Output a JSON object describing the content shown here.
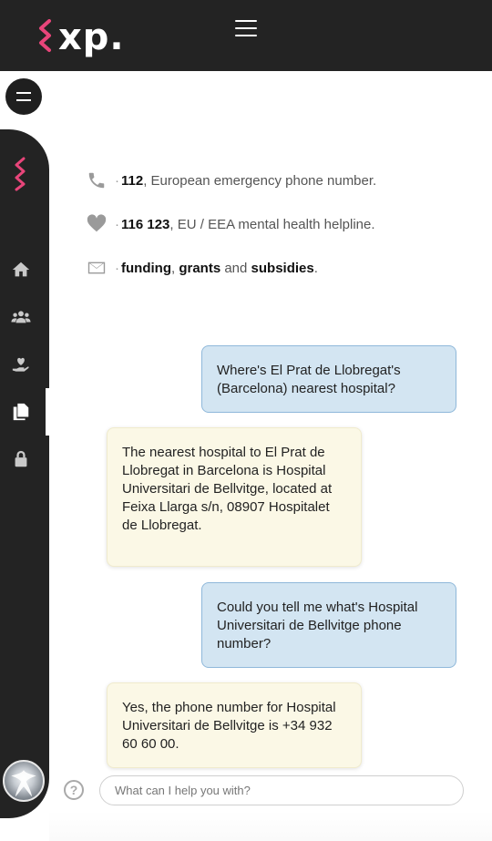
{
  "header": {
    "logo_text": "xp.",
    "brand_color": "#e8457a"
  },
  "sidebar": {
    "items": [
      {
        "icon": "home-icon",
        "active": false
      },
      {
        "icon": "users-icon",
        "active": false
      },
      {
        "icon": "heart-hand-icon",
        "active": false
      },
      {
        "icon": "documents-icon",
        "active": true
      },
      {
        "icon": "lock-icon",
        "active": false
      }
    ]
  },
  "info": {
    "emergency": {
      "number": "112",
      "text": ", European emergency phone number."
    },
    "mental_health": {
      "number": "116 123",
      "text": ", EU / EEA mental health helpline."
    },
    "funding": {
      "funding": "funding",
      "sep1": ", ",
      "grants": "grants",
      "and": " and ",
      "subsidies": "subsidies",
      "end": "."
    }
  },
  "chat": {
    "messages": [
      {
        "role": "user",
        "text": "Where's El Prat de Llobregat's (Barcelona) nearest hospital?"
      },
      {
        "role": "assistant",
        "text": "The nearest hospital to El Prat de Llobregat in Barcelona is Hospital Universitari de Bellvitge, located at Feixa Llarga s/n, 08907 Hospitalet de Llobregat."
      },
      {
        "role": "user",
        "text": "Could you tell me what's Hospital Universitari de Bellvitge phone number?"
      },
      {
        "role": "assistant",
        "text": "Yes, the phone number for Hospital Universitari de Bellvitge is +34 932 60 60 00."
      }
    ],
    "input_placeholder": "What can I help you with?",
    "help_label": "?"
  }
}
